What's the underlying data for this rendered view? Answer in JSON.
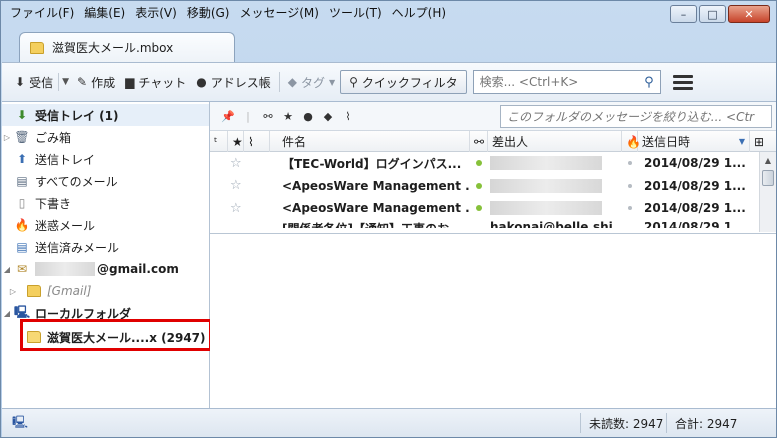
{
  "menubar": {
    "items": [
      "ファイル(F)",
      "編集(E)",
      "表示(V)",
      "移動(G)",
      "メッセージ(M)",
      "ツール(T)",
      "ヘルプ(H)"
    ]
  },
  "window_controls": {
    "minimize": "–",
    "maximize": "□",
    "close": "✕"
  },
  "tab": {
    "title": "滋賀医大メール.mbox"
  },
  "toolbar": {
    "get_mail": "受信",
    "write": "作成",
    "chat": "チャット",
    "address_book": "アドレス帳",
    "tag": "タグ",
    "quick_filter": "クイックフィルタ",
    "search_placeholder": "検索... <Ctrl+K>"
  },
  "folders": [
    {
      "label": "受信トレイ (1)",
      "icon": "inbox-icon"
    },
    {
      "label": "ごみ箱",
      "icon": "trash-icon"
    },
    {
      "label": "送信トレイ",
      "icon": "outbox-icon"
    },
    {
      "label": "すべてのメール",
      "icon": "all-mail-icon"
    },
    {
      "label": "下書き",
      "icon": "drafts-icon"
    },
    {
      "label": "迷惑メール",
      "icon": "junk-icon"
    },
    {
      "label": "送信済みメール",
      "icon": "sent-icon"
    }
  ],
  "account": {
    "suffix": "@gmail.com"
  },
  "gmail_folder": {
    "label": "[Gmail]"
  },
  "local_folders": {
    "label": "ローカルフォルダ"
  },
  "selected_folder": {
    "label": "滋賀医大メール....x (2947)"
  },
  "quick_filter_bar": {
    "placeholder": "このフォルダのメッセージを絞り込む... <Ctr"
  },
  "columns": {
    "subject": "件名",
    "sender": "差出人",
    "date": "送信日時"
  },
  "messages": [
    {
      "subject": "【TEC-World】ログインパス...",
      "date": "2014/08/29 1..."
    },
    {
      "subject": "<ApeosWare Management ...",
      "date": "2014/08/29 1..."
    },
    {
      "subject": "<ApeosWare Management ...",
      "date": "2014/08/29 1..."
    },
    {
      "subject": "[関係者各位]【通知】工事のお...",
      "sender": "hakonai@belle.shi...",
      "date": "2014/08/29 1..."
    }
  ],
  "status": {
    "unread": "未読数: 2947",
    "total": "合計: 2947"
  }
}
